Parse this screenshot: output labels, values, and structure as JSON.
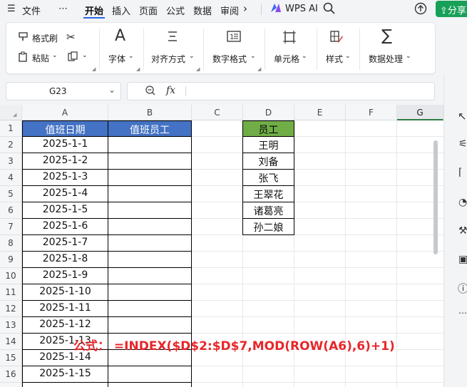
{
  "menubar": {
    "hamburger_label": "文件",
    "more": "⋯",
    "tabs": [
      "开始",
      "插入",
      "页面",
      "公式",
      "数据",
      "审阅"
    ],
    "wps_ai": "WPS AI",
    "share": "分享"
  },
  "ribbon": {
    "format_painter": "格式刷",
    "paste": "粘贴",
    "groups": [
      "字体",
      "对齐方式",
      "数字格式",
      "单元格",
      "样式",
      "数据处理"
    ]
  },
  "namebox": {
    "value": "G23"
  },
  "formula": {
    "fx": "fx",
    "value": ""
  },
  "columns": [
    "A",
    "B",
    "C",
    "D",
    "E",
    "F",
    "G"
  ],
  "selected_column": "G",
  "rows": [
    "1",
    "2",
    "3",
    "4",
    "5",
    "6",
    "7",
    "8",
    "9",
    "10",
    "11",
    "12",
    "13",
    "14",
    "15",
    "16"
  ],
  "table": {
    "header_date": "值班日期",
    "header_staff": "值班员工",
    "dates": [
      "2025-1-1",
      "2025-1-2",
      "2025-1-3",
      "2025-1-4",
      "2025-1-5",
      "2025-1-6",
      "2025-1-7",
      "2025-1-8",
      "2025-1-9",
      "2025-1-10",
      "2025-1-11",
      "2025-1-12",
      "2025-1-13",
      "2025-1-14",
      "2025-1-15"
    ]
  },
  "employees": {
    "header": "员工",
    "names": [
      "王明",
      "刘备",
      "张飞",
      "王翠花",
      "诸葛亮",
      "孙二娘"
    ]
  },
  "formula_note": "公式：  =INDEX($D$2:$D$7,MOD(ROW(A6),6)+1)",
  "colors": {
    "accent": "#2b66e8",
    "share_green": "#18a058",
    "header_blue": "#4472c4",
    "header_green": "#70ad47",
    "note_red": "#e8262a"
  }
}
